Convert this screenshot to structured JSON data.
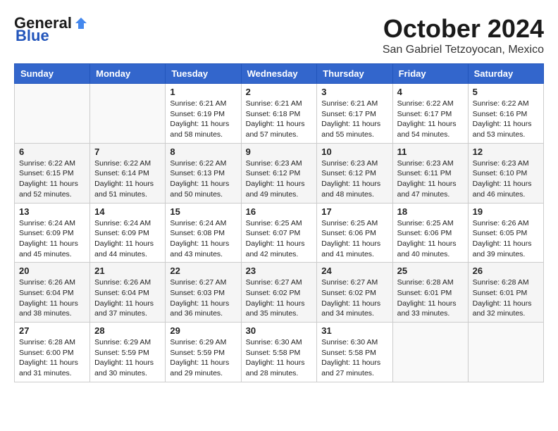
{
  "header": {
    "logo_general": "General",
    "logo_blue": "Blue",
    "month_title": "October 2024",
    "location": "San Gabriel Tetzoyocan, Mexico"
  },
  "calendar": {
    "days_of_week": [
      "Sunday",
      "Monday",
      "Tuesday",
      "Wednesday",
      "Thursday",
      "Friday",
      "Saturday"
    ],
    "weeks": [
      [
        {
          "day": "",
          "info": ""
        },
        {
          "day": "",
          "info": ""
        },
        {
          "day": "1",
          "info": "Sunrise: 6:21 AM\nSunset: 6:19 PM\nDaylight: 11 hours and 58 minutes."
        },
        {
          "day": "2",
          "info": "Sunrise: 6:21 AM\nSunset: 6:18 PM\nDaylight: 11 hours and 57 minutes."
        },
        {
          "day": "3",
          "info": "Sunrise: 6:21 AM\nSunset: 6:17 PM\nDaylight: 11 hours and 55 minutes."
        },
        {
          "day": "4",
          "info": "Sunrise: 6:22 AM\nSunset: 6:17 PM\nDaylight: 11 hours and 54 minutes."
        },
        {
          "day": "5",
          "info": "Sunrise: 6:22 AM\nSunset: 6:16 PM\nDaylight: 11 hours and 53 minutes."
        }
      ],
      [
        {
          "day": "6",
          "info": "Sunrise: 6:22 AM\nSunset: 6:15 PM\nDaylight: 11 hours and 52 minutes."
        },
        {
          "day": "7",
          "info": "Sunrise: 6:22 AM\nSunset: 6:14 PM\nDaylight: 11 hours and 51 minutes."
        },
        {
          "day": "8",
          "info": "Sunrise: 6:22 AM\nSunset: 6:13 PM\nDaylight: 11 hours and 50 minutes."
        },
        {
          "day": "9",
          "info": "Sunrise: 6:23 AM\nSunset: 6:12 PM\nDaylight: 11 hours and 49 minutes."
        },
        {
          "day": "10",
          "info": "Sunrise: 6:23 AM\nSunset: 6:12 PM\nDaylight: 11 hours and 48 minutes."
        },
        {
          "day": "11",
          "info": "Sunrise: 6:23 AM\nSunset: 6:11 PM\nDaylight: 11 hours and 47 minutes."
        },
        {
          "day": "12",
          "info": "Sunrise: 6:23 AM\nSunset: 6:10 PM\nDaylight: 11 hours and 46 minutes."
        }
      ],
      [
        {
          "day": "13",
          "info": "Sunrise: 6:24 AM\nSunset: 6:09 PM\nDaylight: 11 hours and 45 minutes."
        },
        {
          "day": "14",
          "info": "Sunrise: 6:24 AM\nSunset: 6:09 PM\nDaylight: 11 hours and 44 minutes."
        },
        {
          "day": "15",
          "info": "Sunrise: 6:24 AM\nSunset: 6:08 PM\nDaylight: 11 hours and 43 minutes."
        },
        {
          "day": "16",
          "info": "Sunrise: 6:25 AM\nSunset: 6:07 PM\nDaylight: 11 hours and 42 minutes."
        },
        {
          "day": "17",
          "info": "Sunrise: 6:25 AM\nSunset: 6:06 PM\nDaylight: 11 hours and 41 minutes."
        },
        {
          "day": "18",
          "info": "Sunrise: 6:25 AM\nSunset: 6:06 PM\nDaylight: 11 hours and 40 minutes."
        },
        {
          "day": "19",
          "info": "Sunrise: 6:26 AM\nSunset: 6:05 PM\nDaylight: 11 hours and 39 minutes."
        }
      ],
      [
        {
          "day": "20",
          "info": "Sunrise: 6:26 AM\nSunset: 6:04 PM\nDaylight: 11 hours and 38 minutes."
        },
        {
          "day": "21",
          "info": "Sunrise: 6:26 AM\nSunset: 6:04 PM\nDaylight: 11 hours and 37 minutes."
        },
        {
          "day": "22",
          "info": "Sunrise: 6:27 AM\nSunset: 6:03 PM\nDaylight: 11 hours and 36 minutes."
        },
        {
          "day": "23",
          "info": "Sunrise: 6:27 AM\nSunset: 6:02 PM\nDaylight: 11 hours and 35 minutes."
        },
        {
          "day": "24",
          "info": "Sunrise: 6:27 AM\nSunset: 6:02 PM\nDaylight: 11 hours and 34 minutes."
        },
        {
          "day": "25",
          "info": "Sunrise: 6:28 AM\nSunset: 6:01 PM\nDaylight: 11 hours and 33 minutes."
        },
        {
          "day": "26",
          "info": "Sunrise: 6:28 AM\nSunset: 6:01 PM\nDaylight: 11 hours and 32 minutes."
        }
      ],
      [
        {
          "day": "27",
          "info": "Sunrise: 6:28 AM\nSunset: 6:00 PM\nDaylight: 11 hours and 31 minutes."
        },
        {
          "day": "28",
          "info": "Sunrise: 6:29 AM\nSunset: 5:59 PM\nDaylight: 11 hours and 30 minutes."
        },
        {
          "day": "29",
          "info": "Sunrise: 6:29 AM\nSunset: 5:59 PM\nDaylight: 11 hours and 29 minutes."
        },
        {
          "day": "30",
          "info": "Sunrise: 6:30 AM\nSunset: 5:58 PM\nDaylight: 11 hours and 28 minutes."
        },
        {
          "day": "31",
          "info": "Sunrise: 6:30 AM\nSunset: 5:58 PM\nDaylight: 11 hours and 27 minutes."
        },
        {
          "day": "",
          "info": ""
        },
        {
          "day": "",
          "info": ""
        }
      ]
    ]
  }
}
